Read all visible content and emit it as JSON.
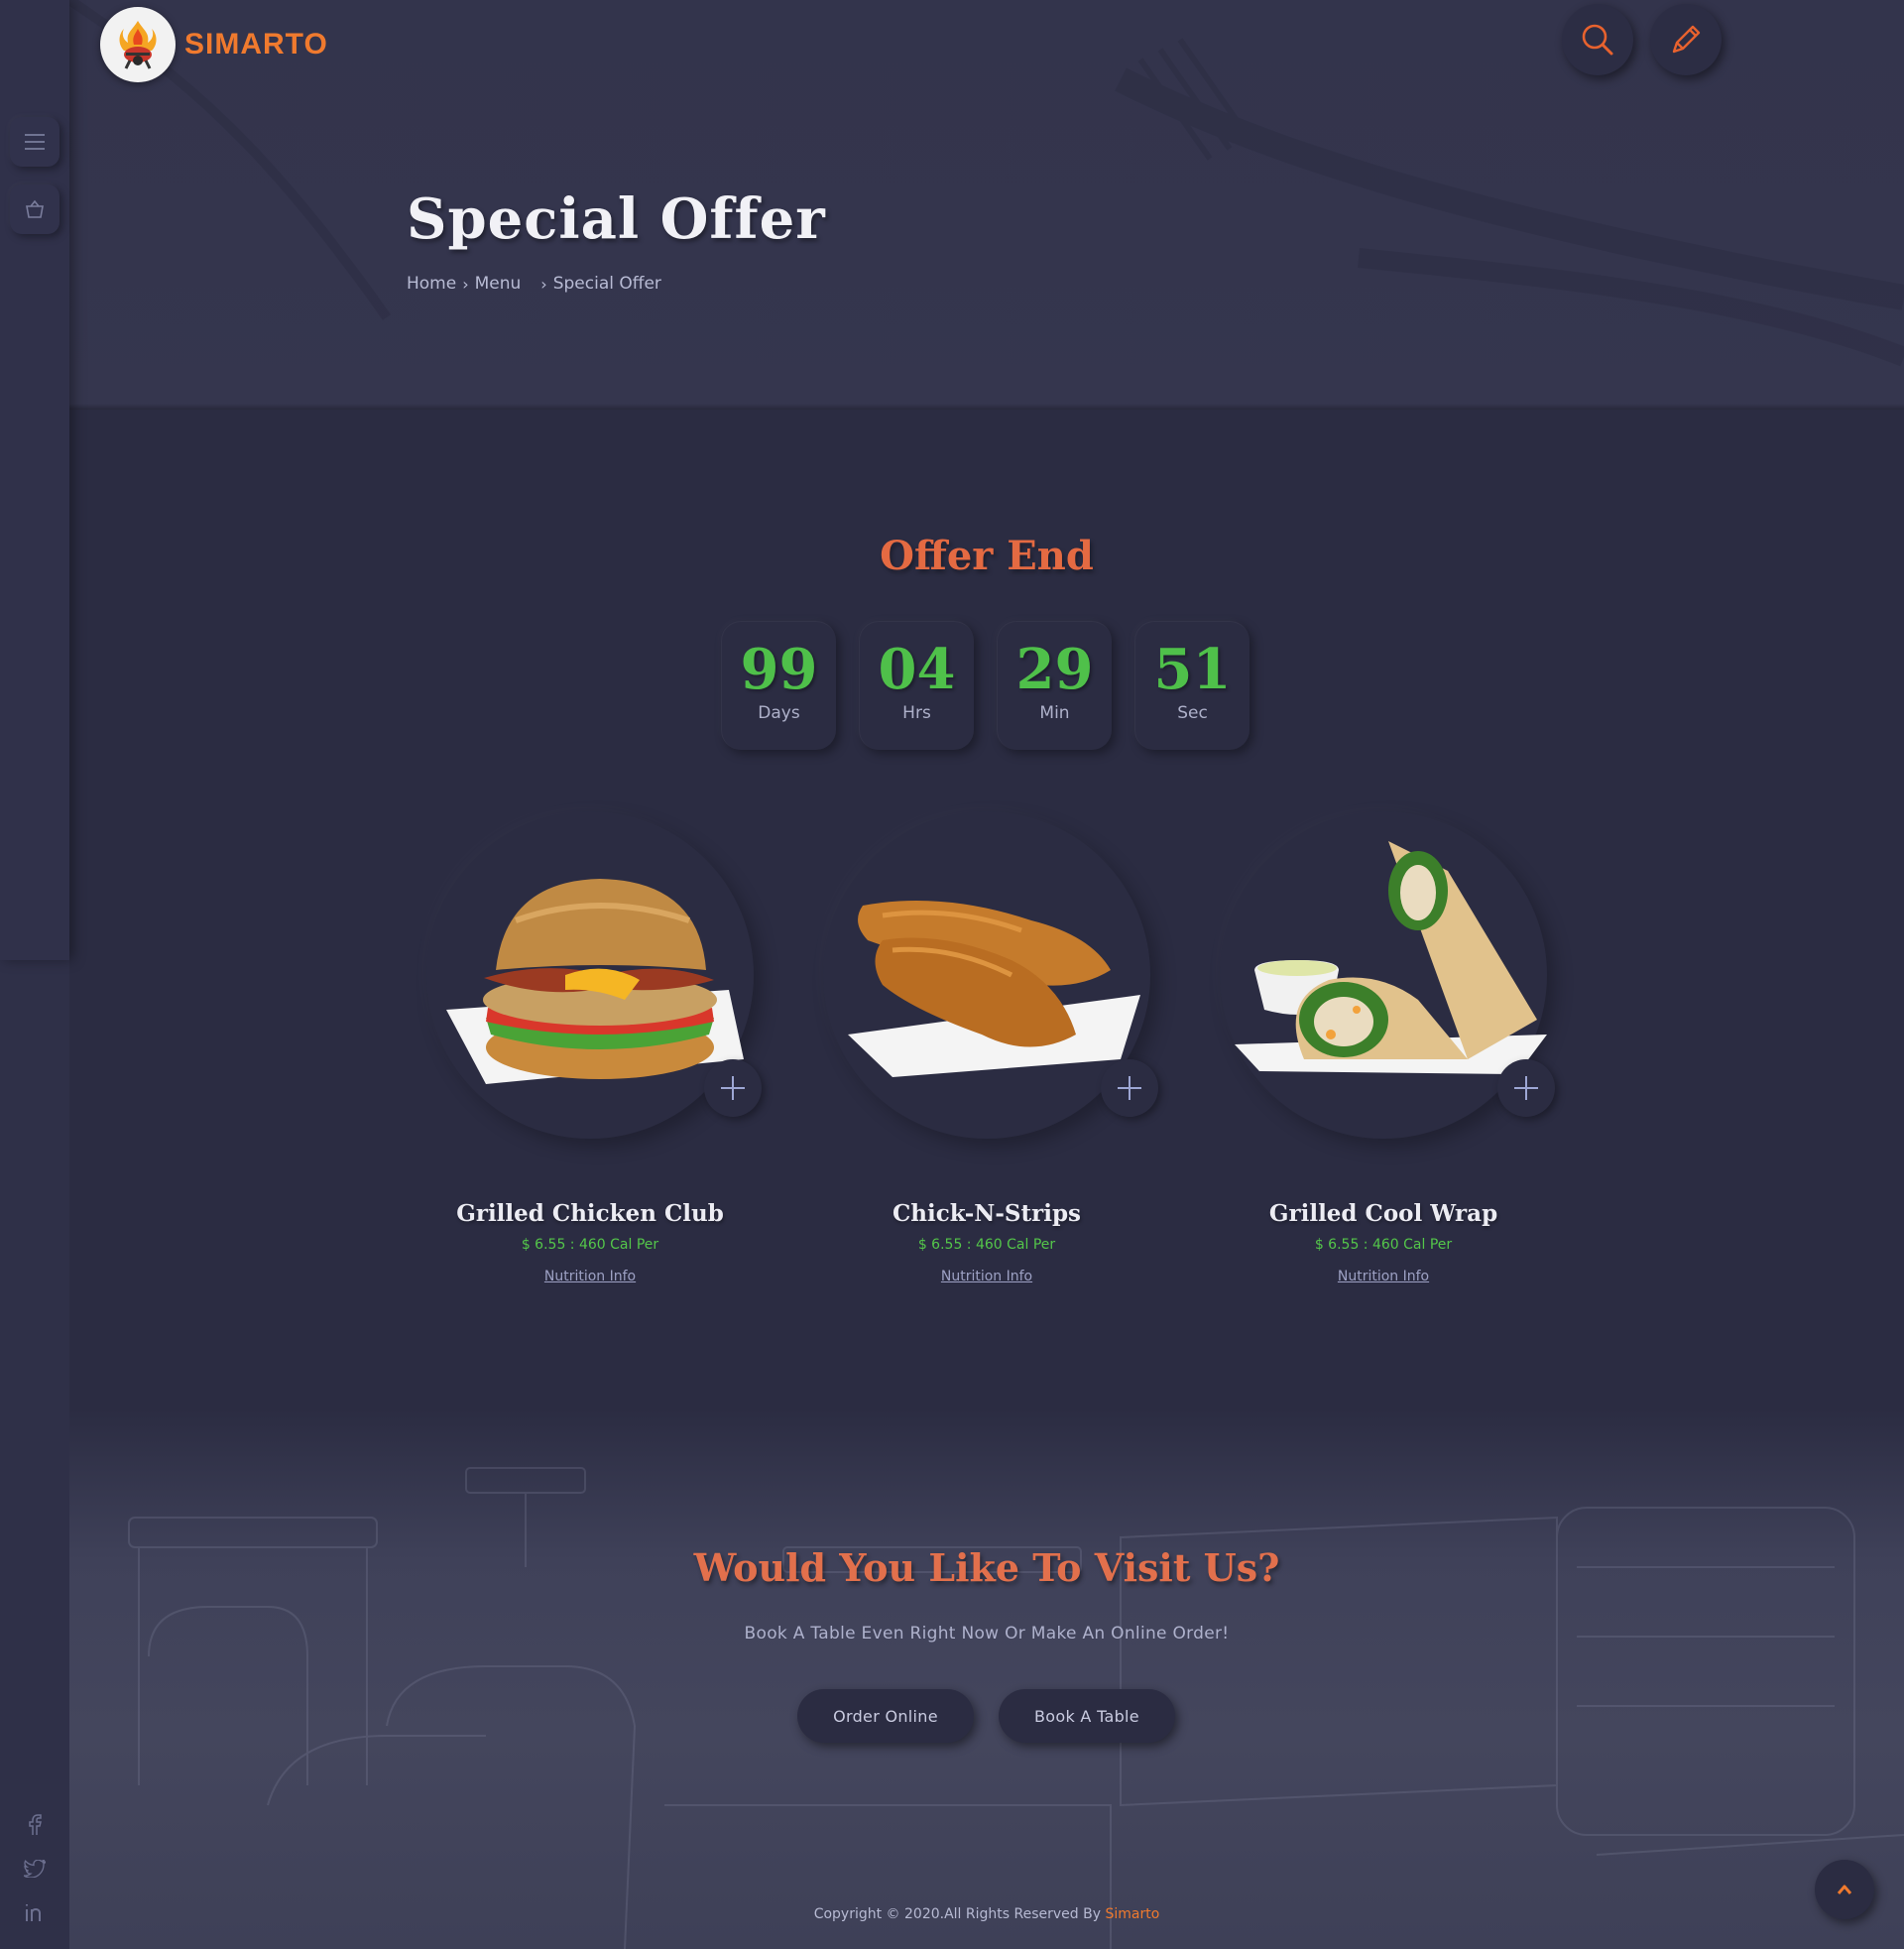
{
  "brand": {
    "name": "SIMARTO"
  },
  "header": {
    "search_icon": "search-icon",
    "edit_icon": "pencil-icon"
  },
  "sidebar": {
    "menu_icon": "hamburger-icon",
    "cart_icon": "basket-icon",
    "social": [
      "facebook-icon",
      "twitter-icon",
      "linkedin-icon"
    ]
  },
  "hero": {
    "title": "Special Offer",
    "breadcrumb": [
      "Home",
      "Menu",
      "Special Offer"
    ]
  },
  "offer": {
    "title": "Offer End",
    "countdown": [
      {
        "value": "99",
        "label": "Days"
      },
      {
        "value": "04",
        "label": "Hrs"
      },
      {
        "value": "29",
        "label": "Min"
      },
      {
        "value": "51",
        "label": "Sec"
      }
    ]
  },
  "products": [
    {
      "name": "Grilled Chicken Club",
      "price": "$ 6.55 : 460 Cal Per",
      "link": "Nutrition Info"
    },
    {
      "name": "Chick-N-Strips",
      "price": "$ 6.55 : 460 Cal Per",
      "link": "Nutrition Info"
    },
    {
      "name": "Grilled Cool Wrap",
      "price": "$ 6.55 : 460 Cal Per",
      "link": "Nutrition Info"
    }
  ],
  "visit": {
    "title": "Would You Like To Visit Us?",
    "subtitle": "Book A Table Even Right Now Or Make An Online Order!",
    "order_button": "Order Online",
    "book_button": "Book A Table"
  },
  "footer": {
    "copyright": "Copyright © 2020.All Rights Reserved By",
    "brand": "Simarto"
  },
  "colors": {
    "accent": "#f07a2e",
    "countdown": "#4fc04a",
    "price": "#54c64a",
    "bg": "#2b2c42"
  }
}
